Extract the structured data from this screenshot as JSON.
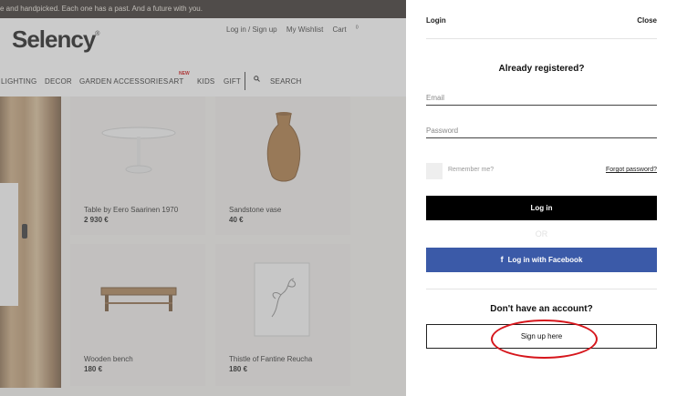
{
  "background_page": {
    "top_banner": "e and handpicked. Each one has a past. And a future with you.",
    "logo": "Selency",
    "logo_mark": "®",
    "header_links": [
      "Log in / Sign up",
      "My Wishlist",
      "Cart"
    ],
    "cart_count": "0",
    "nav": {
      "items": [
        "LIGHTING",
        "DECOR",
        "GARDEN ACCESSORIES",
        "ART",
        "KIDS",
        "GIFT"
      ],
      "new_badge": "NEW",
      "search_label": "SEARCH"
    },
    "products": [
      {
        "name": "Table by Eero Saarinen 1970",
        "price": "2 930 €"
      },
      {
        "name": "Sandstone vase",
        "price": "40 €"
      },
      {
        "name": "Wooden bench",
        "price": "180 €"
      },
      {
        "name": "Thistle of Fantine Reucha",
        "price": "180 €"
      }
    ]
  },
  "drawer": {
    "title": "Login",
    "close": "Close",
    "heading": "Already registered?",
    "email_placeholder": "Email",
    "password_placeholder": "Password",
    "remember": "Remember me?",
    "forgot": "Forgot password?",
    "login_button": "Log in",
    "or": "OR",
    "facebook_icon": "f",
    "facebook_button": "Log in with Facebook",
    "no_account": "Don't have an account?",
    "signup_button": "Sign up here",
    "annotation_color": "#d6161c"
  }
}
